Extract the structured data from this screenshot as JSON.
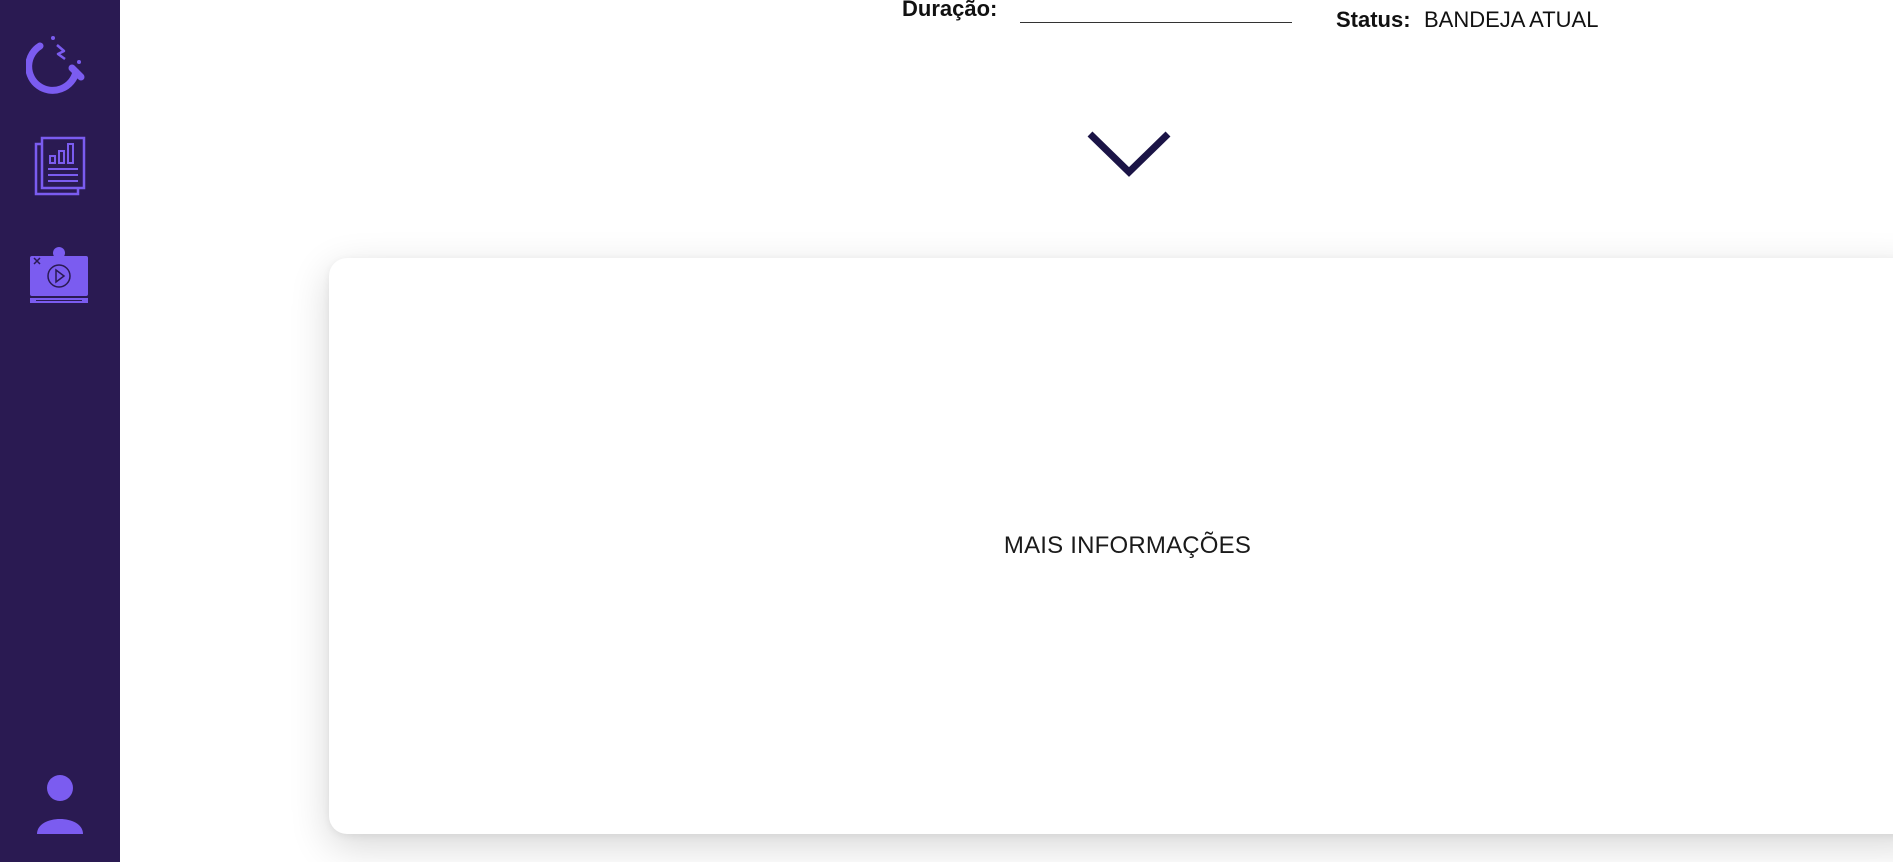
{
  "sidebar": {
    "items": [
      {
        "icon": "magnet-icon"
      },
      {
        "icon": "report-icon"
      },
      {
        "icon": "video-settings-icon"
      }
    ],
    "profile_icon": "user-icon"
  },
  "header": {
    "duration_label": "Duração:",
    "duration_value": "",
    "status_label": "Status:",
    "status_value": "BANDEJA ATUAL"
  },
  "main": {
    "expand_icon": "chevron-down-icon",
    "info_card_label": "MAIS INFORMAÇÕES"
  },
  "colors": {
    "sidebar_bg": "#2a1a52",
    "icon_accent": "#7b5cf0",
    "chevron": "#1b1446",
    "green_accent": "#22c55e"
  }
}
